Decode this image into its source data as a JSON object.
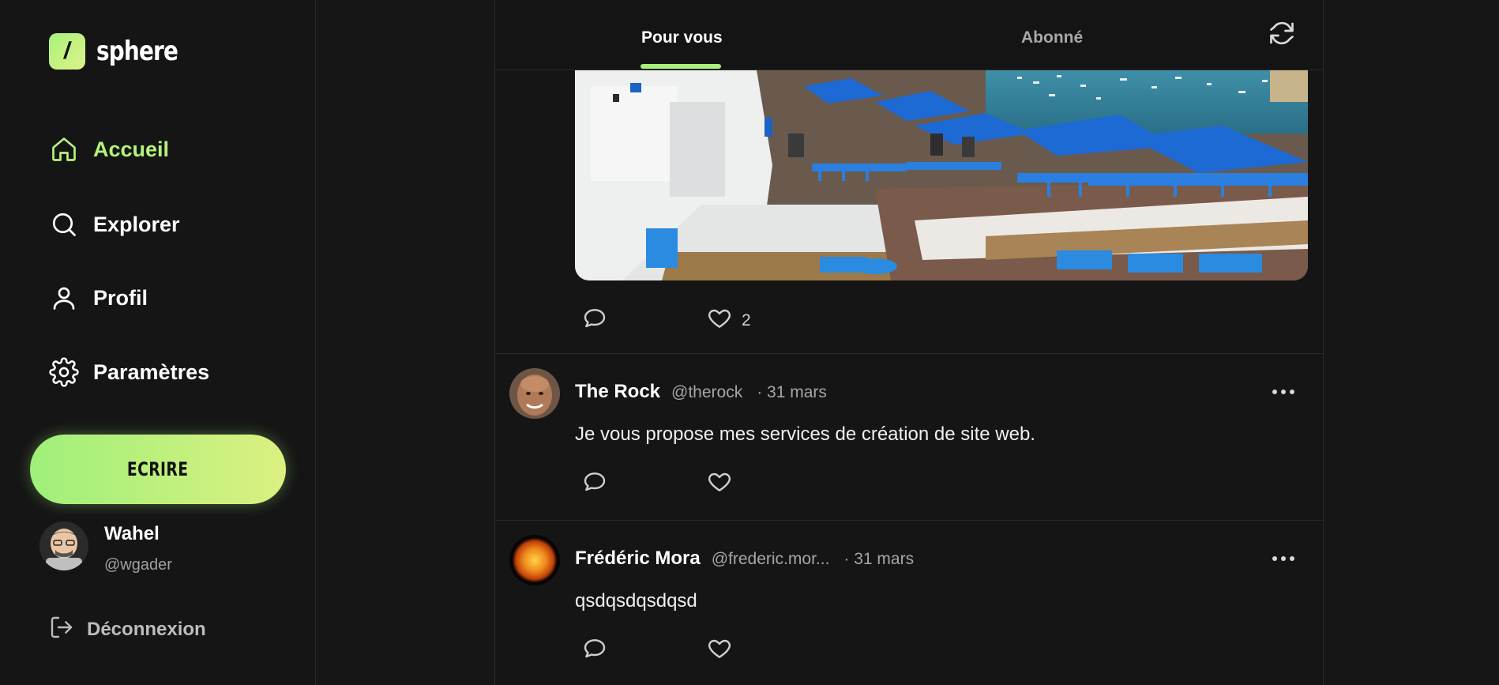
{
  "brand": {
    "name": "sphere",
    "mark": "/",
    "accent": "#a9f07a"
  },
  "nav": {
    "items": [
      {
        "label": "Accueil",
        "icon": "home-icon",
        "active": true
      },
      {
        "label": "Explorer",
        "icon": "search-icon",
        "active": false
      },
      {
        "label": "Profil",
        "icon": "user-icon",
        "active": false
      },
      {
        "label": "Paramètres",
        "icon": "gear-icon",
        "active": false
      }
    ],
    "write_label": "ECRIRE",
    "logout_label": "Déconnexion"
  },
  "current_user": {
    "name": "Wahel",
    "handle": "@wgader"
  },
  "tabs": [
    {
      "label": "Pour vous",
      "active": true
    },
    {
      "label": "Abonné",
      "active": false
    }
  ],
  "posts": [
    {
      "likes": "2",
      "image": "seaside-cafe-photo"
    },
    {
      "name": "The Rock",
      "handle": "@therock",
      "date": "· 31 mars",
      "text": "Je vous propose mes services de création de site web."
    },
    {
      "name": "Frédéric Mora",
      "handle": "@frederic.mor...",
      "date": "· 31 mars",
      "text": "qsdqsdqsdqsd"
    }
  ]
}
